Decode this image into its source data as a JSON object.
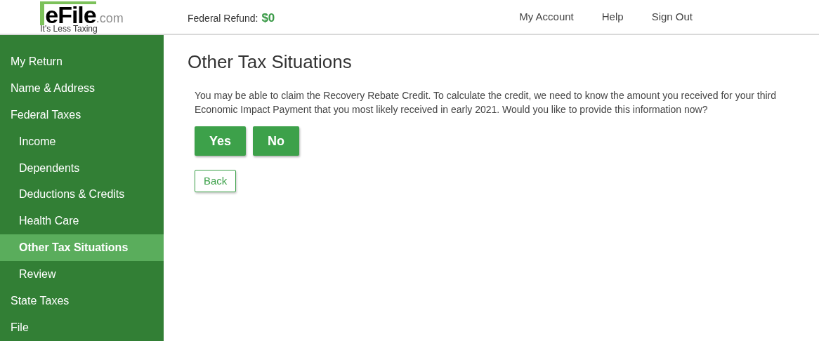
{
  "logo": {
    "name": "eFile",
    "domain": ".com",
    "tagline": "It's Less Taxing"
  },
  "header": {
    "refund_label": "Federal Refund:",
    "refund_amount": "$0",
    "nav": [
      "My Account",
      "Help",
      "Sign Out"
    ]
  },
  "sidebar": {
    "items": [
      {
        "label": "My Return",
        "selected": false
      },
      {
        "label": "Name & Address",
        "selected": false
      },
      {
        "label": "Federal Taxes",
        "selected": false,
        "children": [
          {
            "label": "Income",
            "selected": false
          },
          {
            "label": "Dependents",
            "selected": false
          },
          {
            "label": "Deductions & Credits",
            "selected": false
          },
          {
            "label": "Health Care",
            "selected": false
          },
          {
            "label": "Other Tax Situations",
            "selected": true
          },
          {
            "label": "Review",
            "selected": false
          }
        ]
      },
      {
        "label": "State Taxes",
        "selected": false
      },
      {
        "label": "File",
        "selected": false
      }
    ]
  },
  "main": {
    "title": "Other Tax Situations",
    "message": "You may be able to claim the Recovery Rebate Credit. To calculate the credit, we need to know the amount you received for your third Economic Impact Payment that you most likely received in early 2021. Would you like to provide this information now?",
    "answer_buttons": [
      "Yes",
      "No"
    ],
    "back_button": "Back"
  }
}
